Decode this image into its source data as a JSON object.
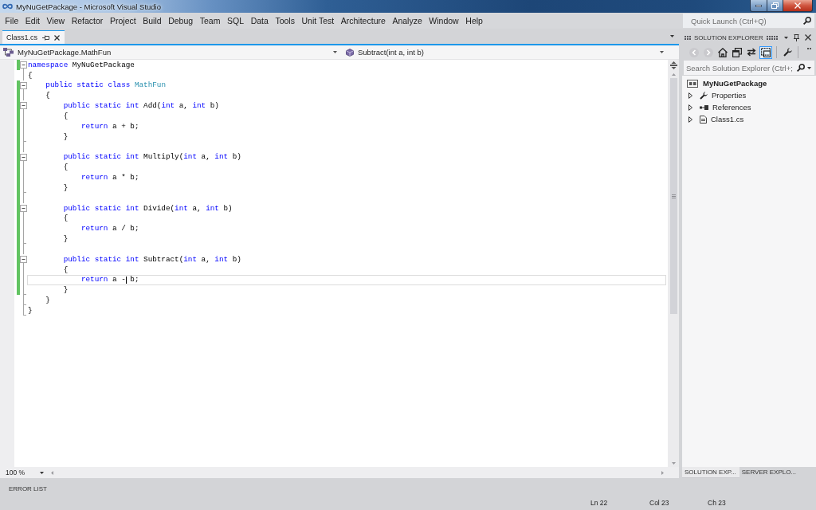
{
  "window": {
    "title": "MyNuGetPackage - Microsoft Visual Studio"
  },
  "menu": [
    "File",
    "Edit",
    "View",
    "Refactor",
    "Project",
    "Build",
    "Debug",
    "Team",
    "SQL",
    "Data",
    "Tools",
    "Unit Test",
    "Architecture",
    "Analyze",
    "Window",
    "Help"
  ],
  "quick_launch": {
    "placeholder": "Quick Launch (Ctrl+Q)"
  },
  "document_tabs": [
    {
      "label": "Class1.cs",
      "selected": true
    }
  ],
  "navigation_bar": {
    "class_dropdown": "MyNuGetPackage.MathFun",
    "member_dropdown": "Subtract(int a, int b)"
  },
  "editor": {
    "lines": [
      {
        "kind": "block_start",
        "changed": true,
        "current": false,
        "tokens": [
          {
            "kind": "keyword",
            "text": "namespace"
          },
          {
            "kind": "plain",
            "text": " MyNuGetPackage"
          }
        ]
      },
      {
        "kind": "block_body",
        "changed": false,
        "current": false,
        "tokens": [
          {
            "kind": "plain",
            "text": "{"
          }
        ]
      },
      {
        "kind": "block_start",
        "changed": true,
        "current": false,
        "tokens": [
          {
            "kind": "keyword",
            "text": "    public static class "
          },
          {
            "kind": "type",
            "text": "MathFun"
          }
        ]
      },
      {
        "kind": "block_body",
        "changed": true,
        "current": false,
        "tokens": [
          {
            "kind": "plain",
            "text": "    {"
          }
        ]
      },
      {
        "kind": "block_start",
        "changed": true,
        "current": false,
        "tokens": [
          {
            "kind": "keyword",
            "text": "        public static int"
          },
          {
            "kind": "plain",
            "text": " Add("
          },
          {
            "kind": "keyword",
            "text": "int"
          },
          {
            "kind": "plain",
            "text": " a, "
          },
          {
            "kind": "keyword",
            "text": "int"
          },
          {
            "kind": "plain",
            "text": " b)"
          }
        ]
      },
      {
        "kind": "block_body",
        "changed": true,
        "current": false,
        "tokens": [
          {
            "kind": "plain",
            "text": "        {"
          }
        ]
      },
      {
        "kind": "block_body",
        "changed": true,
        "current": false,
        "tokens": [
          {
            "kind": "keyword",
            "text": "            return"
          },
          {
            "kind": "plain",
            "text": " a + b;"
          }
        ]
      },
      {
        "kind": "block_end",
        "changed": true,
        "current": false,
        "tokens": [
          {
            "kind": "plain",
            "text": "        }"
          }
        ]
      },
      {
        "kind": "block_body",
        "changed": true,
        "current": false
      },
      {
        "kind": "block_start",
        "changed": true,
        "current": false,
        "tokens": [
          {
            "kind": "keyword",
            "text": "        public static int"
          },
          {
            "kind": "plain",
            "text": " Multiply("
          },
          {
            "kind": "keyword",
            "text": "int"
          },
          {
            "kind": "plain",
            "text": " a, "
          },
          {
            "kind": "keyword",
            "text": "int"
          },
          {
            "kind": "plain",
            "text": " b)"
          }
        ]
      },
      {
        "kind": "block_body",
        "changed": true,
        "current": false,
        "tokens": [
          {
            "kind": "plain",
            "text": "        {"
          }
        ]
      },
      {
        "kind": "block_body",
        "changed": true,
        "current": false,
        "tokens": [
          {
            "kind": "keyword",
            "text": "            return"
          },
          {
            "kind": "plain",
            "text": " a * b;"
          }
        ]
      },
      {
        "kind": "block_end",
        "changed": true,
        "current": false,
        "tokens": [
          {
            "kind": "plain",
            "text": "        }"
          }
        ]
      },
      {
        "kind": "block_body",
        "changed": true,
        "current": false
      },
      {
        "kind": "block_start",
        "changed": true,
        "current": false,
        "tokens": [
          {
            "kind": "keyword",
            "text": "        public static int"
          },
          {
            "kind": "plain",
            "text": " Divide("
          },
          {
            "kind": "keyword",
            "text": "int"
          },
          {
            "kind": "plain",
            "text": " a, "
          },
          {
            "kind": "keyword",
            "text": "int"
          },
          {
            "kind": "plain",
            "text": " b)"
          }
        ]
      },
      {
        "kind": "block_body",
        "changed": true,
        "current": false,
        "tokens": [
          {
            "kind": "plain",
            "text": "        {"
          }
        ]
      },
      {
        "kind": "block_body",
        "changed": true,
        "current": false,
        "tokens": [
          {
            "kind": "keyword",
            "text": "            return"
          },
          {
            "kind": "plain",
            "text": " a / b;"
          }
        ]
      },
      {
        "kind": "block_end",
        "changed": true,
        "current": false,
        "tokens": [
          {
            "kind": "plain",
            "text": "        }"
          }
        ]
      },
      {
        "kind": "block_body",
        "changed": true,
        "current": false
      },
      {
        "kind": "block_start",
        "changed": true,
        "current": false,
        "tokens": [
          {
            "kind": "keyword",
            "text": "        public static int"
          },
          {
            "kind": "plain",
            "text": " Subtract("
          },
          {
            "kind": "keyword",
            "text": "int"
          },
          {
            "kind": "plain",
            "text": " a, "
          },
          {
            "kind": "keyword",
            "text": "int"
          },
          {
            "kind": "plain",
            "text": " b)"
          }
        ]
      },
      {
        "kind": "block_body",
        "changed": true,
        "current": false,
        "tokens": [
          {
            "kind": "plain",
            "text": "        {"
          }
        ]
      },
      {
        "kind": "block_body",
        "changed": true,
        "current": true,
        "tokens": [
          {
            "kind": "keyword",
            "text": "            return"
          },
          {
            "kind": "plain",
            "text": " a -"
          },
          {
            "kind": "caret"
          },
          {
            "kind": "plain",
            "text": " b;"
          }
        ]
      },
      {
        "kind": "block_end",
        "changed": true,
        "current": false,
        "tokens": [
          {
            "kind": "plain",
            "text": "        }"
          }
        ]
      },
      {
        "kind": "block_end",
        "changed": false,
        "current": false,
        "tokens": [
          {
            "kind": "plain",
            "text": "    }"
          }
        ]
      },
      {
        "kind": "block_end",
        "changed": false,
        "current": false,
        "tokens": [
          {
            "kind": "plain",
            "text": "}"
          }
        ]
      }
    ],
    "zoom": "100 %"
  },
  "solution_explorer": {
    "title": "SOLUTION EXPLORER",
    "toolbar_groups": [
      {
        "buttons": [
          {
            "kind": "back",
            "disabled": true,
            "pressed": false
          },
          {
            "kind": "forward",
            "disabled": true,
            "pressed": false
          },
          {
            "kind": "home",
            "disabled": false,
            "pressed": false
          },
          {
            "kind": "collapse_all",
            "disabled": false,
            "pressed": false
          },
          {
            "kind": "sync",
            "disabled": false,
            "pressed": false
          },
          {
            "kind": "show_all_files",
            "disabled": false,
            "pressed": true
          }
        ]
      },
      {
        "buttons": [
          {
            "kind": "properties",
            "disabled": false,
            "pressed": false
          }
        ]
      }
    ],
    "search": {
      "placeholder": "Search Solution Explorer (Ctrl+;"
    },
    "tree": [
      {
        "label": "MyNuGetPackage",
        "kind": "project",
        "selected": false,
        "children": [
          {
            "label": "Properties",
            "kind": "properties",
            "expanded": false,
            "selected": false
          },
          {
            "label": "References",
            "kind": "references",
            "expanded": false,
            "selected": false
          },
          {
            "label": "Class1.cs",
            "kind": "code_file",
            "expanded": false,
            "selected": false
          }
        ]
      }
    ],
    "tabs": [
      {
        "label": "SOLUTION EXP...",
        "selected": true
      },
      {
        "label": "SERVER EXPLO...",
        "selected": false
      }
    ]
  },
  "error_list": {
    "label": "ERROR LIST"
  },
  "status_bar": {
    "line": "Ln 22",
    "column": "Col 23",
    "character": "Ch 23"
  }
}
